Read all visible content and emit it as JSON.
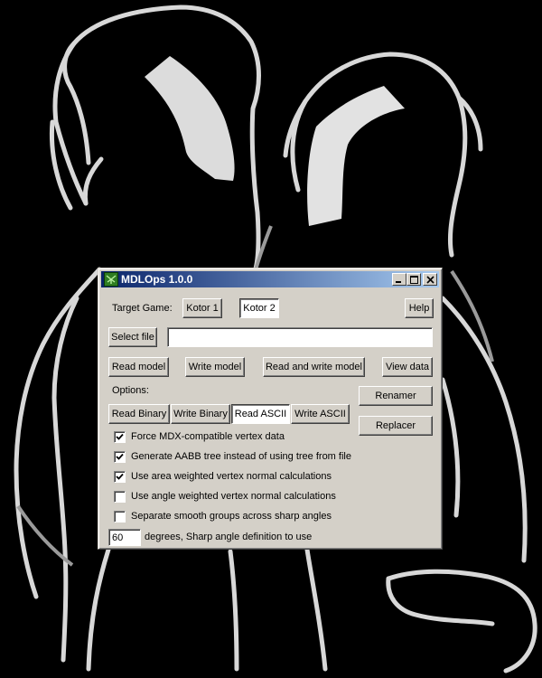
{
  "window": {
    "title": "MDLOps 1.0.0"
  },
  "target_game": {
    "label": "Target Game:",
    "kotor1": "Kotor 1",
    "kotor2": "Kotor 2",
    "selected": "Kotor 2"
  },
  "help_label": "Help",
  "file": {
    "select_label": "Select file",
    "value": ""
  },
  "actions": {
    "read_model": "Read model",
    "write_model": "Write model",
    "read_and_write": "Read and write model",
    "view_data": "View data"
  },
  "options": {
    "label": "Options:",
    "modes": [
      "Read Binary",
      "Write Binary",
      "Read ASCII",
      "Write ASCII"
    ],
    "selected_mode": "Read ASCII"
  },
  "side_buttons": {
    "renamer": "Renamer",
    "replacer": "Replacer"
  },
  "checkboxes": [
    {
      "label": "Force MDX-compatible vertex data",
      "checked": true
    },
    {
      "label": "Generate AABB tree instead of using tree from file",
      "checked": true
    },
    {
      "label": "Use area weighted vertex normal calculations",
      "checked": true
    },
    {
      "label": "Use angle weighted vertex normal calculations",
      "checked": false
    },
    {
      "label": "Separate smooth groups across sharp angles",
      "checked": false
    }
  ],
  "sharp_angle": {
    "value": "60",
    "label": "degrees, Sharp angle definition to use"
  },
  "icons": {
    "app": "mdlops-icon",
    "minimize": "minimize-icon",
    "maximize": "maximize-icon",
    "close": "close-icon",
    "check": "checkmark-icon"
  }
}
